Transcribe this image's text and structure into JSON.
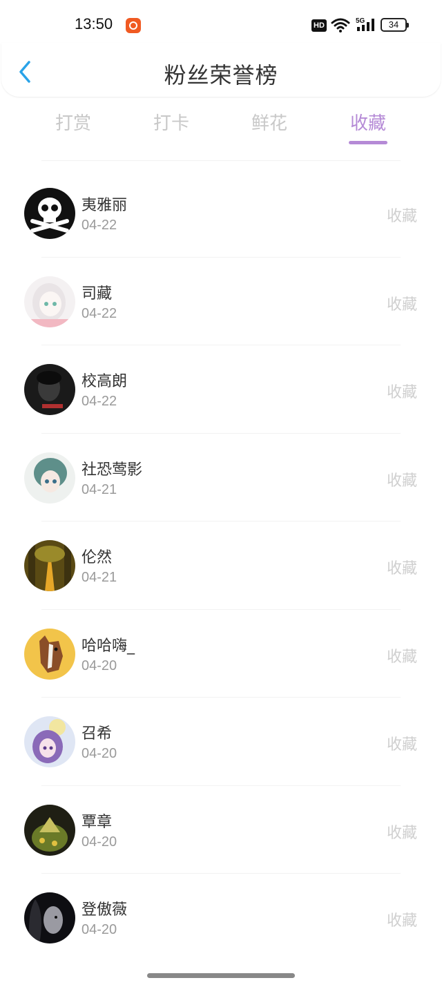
{
  "status_bar": {
    "time": "13:50",
    "hd": "HD",
    "network": "5G",
    "battery": "34",
    "icons": [
      "app-notification-icon",
      "wifi-icon",
      "cellular-signal-icon",
      "battery-icon"
    ]
  },
  "header": {
    "title": "粉丝荣誉榜",
    "back_icon": "chevron-left-icon"
  },
  "colors": {
    "accent": "#b58ad6",
    "back": "#2aa3e8"
  },
  "tabs": [
    {
      "label": "打赏",
      "active": false
    },
    {
      "label": "打卡",
      "active": false
    },
    {
      "label": "鲜花",
      "active": false
    },
    {
      "label": "收藏",
      "active": true
    }
  ],
  "fans": [
    {
      "name": "夷雅丽",
      "date": "04-22",
      "action": "收藏"
    },
    {
      "name": "司藏",
      "date": "04-22",
      "action": "收藏"
    },
    {
      "name": "校高朗",
      "date": "04-22",
      "action": "收藏"
    },
    {
      "name": "社恐莺影",
      "date": "04-21",
      "action": "收藏"
    },
    {
      "name": "伦然",
      "date": "04-21",
      "action": "收藏"
    },
    {
      "name": "哈哈嗨_",
      "date": "04-20",
      "action": "收藏"
    },
    {
      "name": "召希",
      "date": "04-20",
      "action": "收藏"
    },
    {
      "name": "覃章",
      "date": "04-20",
      "action": "收藏"
    },
    {
      "name": "登傲薇",
      "date": "04-20",
      "action": "收藏"
    }
  ]
}
